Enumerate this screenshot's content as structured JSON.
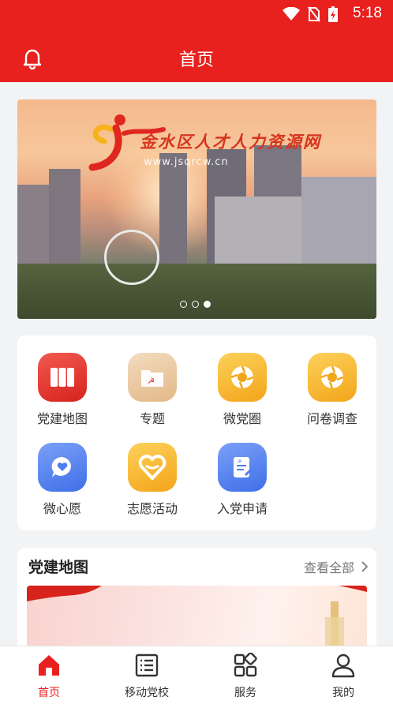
{
  "status_bar": {
    "time": "5:18"
  },
  "header": {
    "title": "首页"
  },
  "banner": {
    "title": "金水区人才人力资源网",
    "url": "www.jsqrcw.cn",
    "dots": 3,
    "active_dot": 2
  },
  "grid": [
    {
      "label": "党建地图",
      "icon": "map-book-icon",
      "color": "#e8302b"
    },
    {
      "label": "专题",
      "icon": "folder-icon",
      "color": "#e9c69b"
    },
    {
      "label": "微党圈",
      "icon": "aperture-icon",
      "color": "#f7b62a"
    },
    {
      "label": "问卷调查",
      "icon": "aperture-icon",
      "color": "#f7b62a"
    },
    {
      "label": "微心愿",
      "icon": "heart-chat-icon",
      "color": "#4f7ef0"
    },
    {
      "label": "志愿活动",
      "icon": "heart-icon",
      "color": "#f7b62a"
    },
    {
      "label": "入党申请",
      "icon": "application-icon",
      "color": "#4f7ef0"
    }
  ],
  "section": {
    "title": "党建地图",
    "more": "查看全部"
  },
  "tabs": [
    {
      "label": "首页",
      "icon": "home-icon",
      "active": true
    },
    {
      "label": "移动党校",
      "icon": "list-icon",
      "active": false
    },
    {
      "label": "服务",
      "icon": "grid-icon",
      "active": false
    },
    {
      "label": "我的",
      "icon": "user-icon",
      "active": false
    }
  ],
  "colors": {
    "primary": "#e8201e"
  }
}
